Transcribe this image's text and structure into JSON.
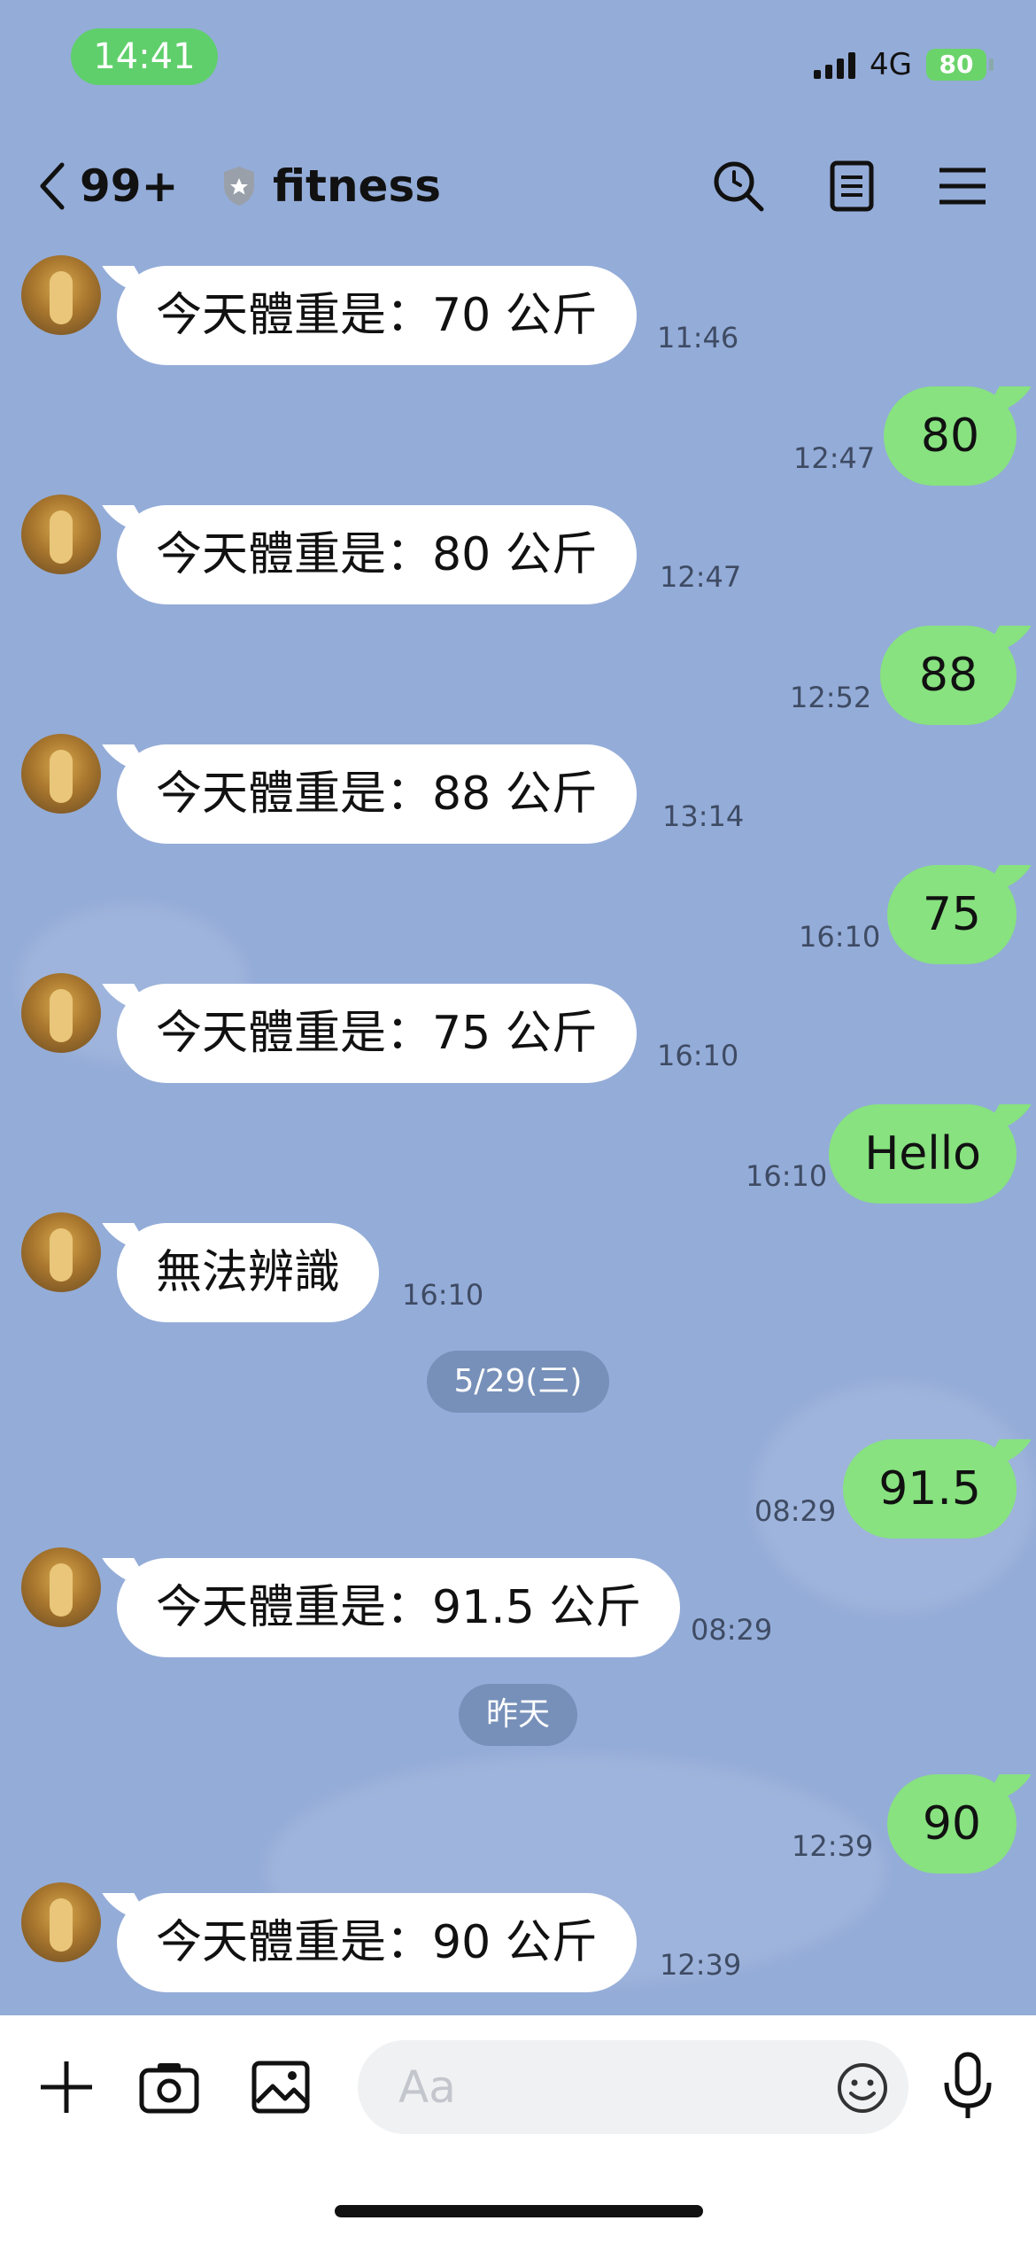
{
  "status": {
    "time": "14:41",
    "network": "4G",
    "battery": "80"
  },
  "header": {
    "back_count": "99+",
    "title": "fitness",
    "icons": [
      "search-icon",
      "notes-icon",
      "menu-icon"
    ]
  },
  "messages": [
    {
      "dir": "in",
      "text": "今天體重是：70 公斤",
      "time": "11:46"
    },
    {
      "dir": "out",
      "text": "80",
      "time": "12:47"
    },
    {
      "dir": "in",
      "text": "今天體重是：80 公斤",
      "time": "12:47"
    },
    {
      "dir": "out",
      "text": "88",
      "time": "12:52"
    },
    {
      "dir": "in",
      "text": "今天體重是：88 公斤",
      "time": "13:14"
    },
    {
      "dir": "out",
      "text": "75",
      "time": "16:10"
    },
    {
      "dir": "in",
      "text": "今天體重是：75 公斤",
      "time": "16:10"
    },
    {
      "dir": "out",
      "text": "Hello",
      "time": "16:10"
    },
    {
      "dir": "in",
      "text": "無法辨識",
      "time": "16:10"
    },
    {
      "dir": "date",
      "text": "5/29(三)"
    },
    {
      "dir": "out",
      "text": "91.5",
      "time": "08:29"
    },
    {
      "dir": "in",
      "text": "今天體重是：91.5 公斤",
      "time": "08:29"
    },
    {
      "dir": "date",
      "text": "昨天"
    },
    {
      "dir": "out",
      "text": "90",
      "time": "12:39"
    },
    {
      "dir": "in",
      "text": "今天體重是：90 公斤",
      "time": "12:39"
    }
  ],
  "input": {
    "placeholder": "Aa",
    "icons": [
      "plus-icon",
      "camera-icon",
      "image-icon",
      "emoji-icon",
      "microphone-icon"
    ]
  }
}
